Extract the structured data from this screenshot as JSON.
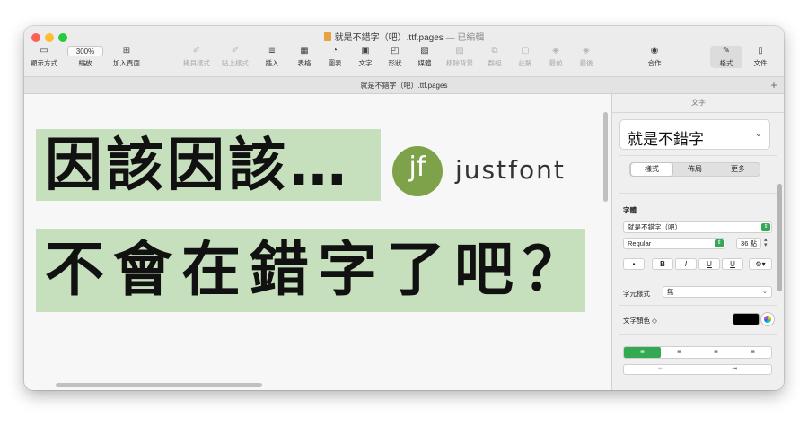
{
  "window": {
    "title": "就是不錯字（吧）.ttf.pages",
    "title_suffix": "— 已編輯"
  },
  "toolbar": {
    "view_label": "顯示方式",
    "zoom_value": "300%",
    "zoom_label": "縮放",
    "add_page_label": "加入頁面",
    "copy_style_label": "拷貝樣式",
    "paste_style_label": "貼上樣式",
    "insert_label": "插入",
    "table_label": "表格",
    "chart_label": "圖表",
    "text_label": "文字",
    "shape_label": "形狀",
    "media_label": "媒體",
    "remove_bg_label": "移除背景",
    "group_label": "群組",
    "comment_label": "註解",
    "front_label": "最前",
    "back_label": "最後",
    "collaborate_label": "合作",
    "format_label": "格式",
    "document_label": "文件"
  },
  "tabbar": {
    "tab_label": "就是不錯字（吧）.ttf.pages",
    "add_tab": "+"
  },
  "canvas": {
    "line1": "因該因該…",
    "line2": "不會在錯字了吧？",
    "logo_mark": "jf",
    "logo_text": "justfont"
  },
  "panel": {
    "title": "文字",
    "paragraph_style": "就是不錯字",
    "tabs": [
      "樣式",
      "佈局",
      "更多"
    ],
    "font_section_label": "字體",
    "font_family": "就是不錯字（吧）",
    "font_weight": "Regular",
    "font_size": "36 點",
    "bullet": "•",
    "bold": "B",
    "italic": "I",
    "underline": "U",
    "strike": "U",
    "more_options": "⚙▾",
    "char_style_label": "字元樣式",
    "char_style_value": "無",
    "text_color_label": "文字顏色 ◇",
    "text_color": "#000000",
    "accent_color": "#34a853",
    "highlight_color": "#c6dfbd"
  }
}
